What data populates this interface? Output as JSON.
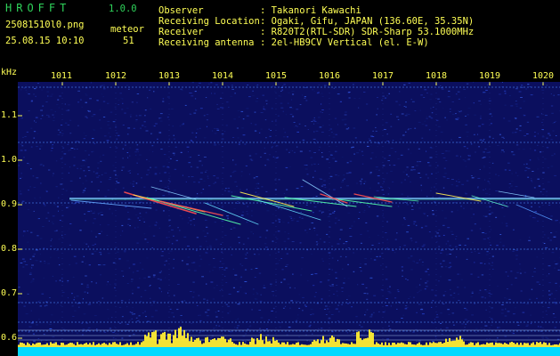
{
  "header": {
    "logo": "HROFFT",
    "version": "1.0.0",
    "filename": "25081510l0.png",
    "event_label": "meteor",
    "datetime": "25.08.15 10:10",
    "count": "51",
    "info": [
      {
        "key": "Observer",
        "value": ": Takanori Kawachi"
      },
      {
        "key": "Receiving Location",
        "value": ": Ogaki, Gifu, JAPAN (136.60E, 35.35N)"
      },
      {
        "key": "Receiver",
        "value": ": R820T2(RTL-SDR) SDR-Sharp 53.1000MHz"
      },
      {
        "key": "Receiving antenna",
        "value": ": 2el-HB9CV Vertical (el. E-W)"
      }
    ]
  },
  "axes": {
    "y_unit": "kHz",
    "x_ticks": [
      "1011",
      "1012",
      "1013",
      "1014",
      "1015",
      "1016",
      "1017",
      "1018",
      "1019",
      "1020"
    ],
    "y_ticks": [
      "1.1",
      "1.0",
      "0.9",
      "0.8",
      "0.7",
      "0.6"
    ]
  },
  "colors": {
    "background": "#000000",
    "header_text": "#ffff55",
    "label_text": "#2fd35b",
    "noise_base": "#0b0f5e",
    "carrier": "#7fd3ff",
    "trace_hot": "#ff5050",
    "trace_warm": "#ffee55",
    "trace_cool": "#55ffaa",
    "grid": "#3c6bd6",
    "activity_bar": "#00d9ff",
    "activity_peak": "#ffee33"
  }
}
